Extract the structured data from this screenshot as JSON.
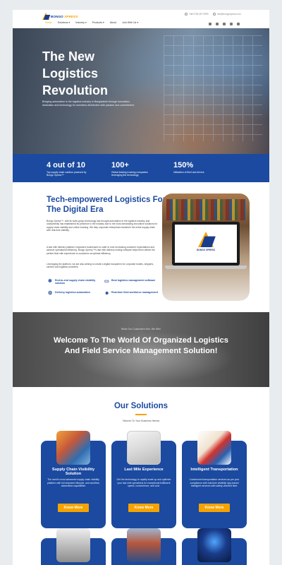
{
  "header": {
    "logo_text": "BONGO",
    "logo_sub": "XPRESS",
    "phone": "+88 0755 497 9999",
    "email": "info@bongoxpress.com",
    "nav": [
      {
        "label": "Home",
        "active": true
      },
      {
        "label": "Solutions ▾"
      },
      {
        "label": "Industry ▾"
      },
      {
        "label": "Products ▾"
      },
      {
        "label": "About"
      },
      {
        "label": "Join With Us ▾"
      }
    ],
    "social_icons": [
      "facebook-icon",
      "instagram-icon",
      "twitter-icon",
      "linkedin-icon",
      "youtube-icon"
    ]
  },
  "hero": {
    "title": "The New\nLogistics\nRevolution",
    "subtitle": "Bringing automation in the logistics industry in Bangladesh through innovation, dedication and technology for seamless distribution with passion and commitment."
  },
  "stats": [
    {
      "num": "4 out of 10",
      "label": "Top supply chain solution powered by Bongo Xpress™"
    },
    {
      "num": "100+",
      "label": "Global leading trucking companies leveraging the technology"
    },
    {
      "num": "150%",
      "label": "Utilization of fleet and drivers"
    }
  ],
  "about": {
    "title": "Tech-empowered Logistics For The Digital Era",
    "p1": "Bongo Xpress™, with its suite-group technology has brought automation in the logistics industry and undoubtedly has established its presence in the industry due to the most demanding innovative solutions for supply chain visibility and online trucking. We help corporate enterprises transform the entire supply chain with real-time visibility.",
    "p2": "A last mile delivery platform empowers businesses to cater to ever-increasing customer expectations and achieve operational efficiency. Bongo Xpress™'s last mile delivery routing software helps them deliver the perfect final mile experience to customers at optimal efficiency.",
    "p3": "Leveraging the platform, we are also aiming to create a digital ecosystem for corporate bodies, shippers, carriers and logistics providers.",
    "features": [
      {
        "icon": "snowflake-icon",
        "label": "End-to-end supply chain visibility solution"
      },
      {
        "icon": "monitor-icon",
        "label": "Best logistics management software"
      },
      {
        "icon": "handshake-icon",
        "label": "Delivery logistics automation"
      },
      {
        "icon": "team-icon",
        "label": "Real-time field workforce management"
      }
    ],
    "screen_text": "BONGO XPRESS"
  },
  "welcome": {
    "pre": "What Our Customers Win, We Win!",
    "title": "Welcome To The World Of Organized Logistics And Field Service Management Solution!"
  },
  "solutions": {
    "title": "Our Solutions",
    "subtitle": "Tailored To Your Business Needs",
    "cards": [
      {
        "title": "Supply Chain Visibility Solution",
        "desc": "The world's most advanced supply chain visibility platform with full shipment lifecycle, and workflow automation capabilities",
        "button": "Know More"
      },
      {
        "title": "Last Mile Experience",
        "desc": "Get the technology to rapidly scale up and optimize your last mile operations for exceptional fulfillment speed, convenience, and cost.",
        "button": "Know More"
      },
      {
        "title": "Intelligent Transportation",
        "desc": "Customized transportation services as per your compliance with real-time visibility! App-based intelligent services with safety-oriented fleet.",
        "button": "Know More"
      }
    ]
  },
  "colors": {
    "brand_blue": "#1b4aa0",
    "accent_orange": "#f5a300"
  }
}
